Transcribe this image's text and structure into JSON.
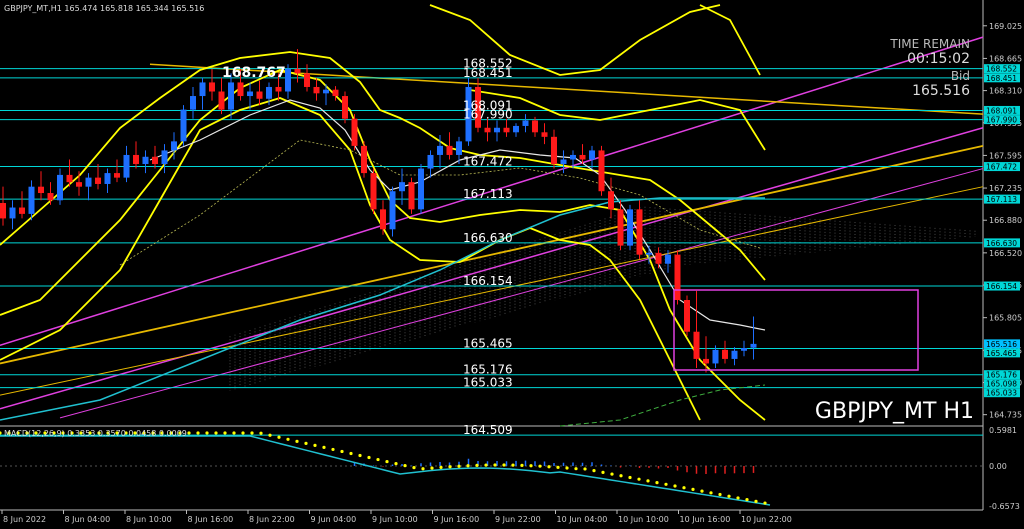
{
  "header": {
    "text": "GBPJPY_MT,H1  165.474 165.818 165.344 165.516"
  },
  "info_box": {
    "time_label": "TIME REMAIN",
    "time_value": "00:15:02",
    "bid_label": "Bid",
    "bid_value": "165.516"
  },
  "watermark": "GBPJPY_MT H1",
  "high_label": "168.767",
  "macd_header": "MACD(12,26,9) 0.3353 0.3570 0.0458 0.0009",
  "colors": {
    "bull": "#1e6fff",
    "bear": "#ff1a1a",
    "level": "#00d7d7",
    "yellow": "#ffff00",
    "magenta": "#e040e0",
    "orange": "#e6b800",
    "white_ma": "#e6e6e6",
    "cyan_ma": "#20c0d0"
  },
  "chart_data": {
    "type": "candlestick",
    "symbol": "GBPJPY_MT",
    "timeframe": "H1",
    "price_axis_ticks": [
      169.025,
      168.665,
      168.31,
      167.955,
      167.595,
      167.235,
      166.88,
      166.52,
      166.165,
      165.805,
      165.445,
      165.09,
      164.735
    ],
    "time_axis_ticks": [
      "8 Jun 2022",
      "8 Jun 04:00",
      "8 Jun 10:00",
      "8 Jun 16:00",
      "8 Jun 22:00",
      "9 Jun 04:00",
      "9 Jun 10:00",
      "9 Jun 16:00",
      "9 Jun 22:00",
      "10 Jun 04:00",
      "10 Jun 10:00",
      "10 Jun 16:00",
      "10 Jun 22:00"
    ],
    "horizontal_levels": [
      {
        "price": 168.552,
        "label": "168.552"
      },
      {
        "price": 168.451,
        "label": "168.451"
      },
      {
        "price": 168.091,
        "label": "168.091"
      },
      {
        "price": 167.99,
        "label": "167.990"
      },
      {
        "price": 167.472,
        "label": "167.472"
      },
      {
        "price": 167.113,
        "label": "167.113"
      },
      {
        "price": 166.63,
        "label": "166.630"
      },
      {
        "price": 166.154,
        "label": "166.154"
      },
      {
        "price": 165.465,
        "label": "165.465"
      },
      {
        "price": 165.176,
        "label": "165.176"
      },
      {
        "price": 165.033,
        "label": "165.033"
      },
      {
        "price": 164.509,
        "label": "164.509"
      }
    ],
    "right_axis_level_tags": [
      "168.552",
      "168.451",
      "168.091",
      "167.990",
      "167.472",
      "167.113",
      "166.630",
      "166.154",
      "165.516",
      "165.465",
      "165.176",
      "165.098",
      "165.033"
    ],
    "candles": [
      {
        "o": 167.07,
        "h": 167.25,
        "l": 166.82,
        "c": 166.9
      },
      {
        "o": 166.9,
        "h": 167.1,
        "l": 166.78,
        "c": 167.02
      },
      {
        "o": 167.02,
        "h": 167.2,
        "l": 166.9,
        "c": 166.95
      },
      {
        "o": 166.95,
        "h": 167.32,
        "l": 166.88,
        "c": 167.25
      },
      {
        "o": 167.25,
        "h": 167.42,
        "l": 167.1,
        "c": 167.18
      },
      {
        "o": 167.18,
        "h": 167.3,
        "l": 167.05,
        "c": 167.1
      },
      {
        "o": 167.1,
        "h": 167.45,
        "l": 167.05,
        "c": 167.38
      },
      {
        "o": 167.38,
        "h": 167.55,
        "l": 167.25,
        "c": 167.3
      },
      {
        "o": 167.3,
        "h": 167.42,
        "l": 167.15,
        "c": 167.25
      },
      {
        "o": 167.25,
        "h": 167.4,
        "l": 167.1,
        "c": 167.35
      },
      {
        "o": 167.35,
        "h": 167.5,
        "l": 167.22,
        "c": 167.28
      },
      {
        "o": 167.28,
        "h": 167.45,
        "l": 167.18,
        "c": 167.4
      },
      {
        "o": 167.4,
        "h": 167.55,
        "l": 167.3,
        "c": 167.35
      },
      {
        "o": 167.35,
        "h": 167.7,
        "l": 167.3,
        "c": 167.6
      },
      {
        "o": 167.6,
        "h": 167.75,
        "l": 167.45,
        "c": 167.5
      },
      {
        "o": 167.5,
        "h": 167.65,
        "l": 167.4,
        "c": 167.58
      },
      {
        "o": 167.58,
        "h": 167.7,
        "l": 167.45,
        "c": 167.5
      },
      {
        "o": 167.5,
        "h": 167.72,
        "l": 167.4,
        "c": 167.65
      },
      {
        "o": 167.65,
        "h": 167.85,
        "l": 167.55,
        "c": 167.75
      },
      {
        "o": 167.75,
        "h": 168.15,
        "l": 167.7,
        "c": 168.1
      },
      {
        "o": 168.1,
        "h": 168.35,
        "l": 168.0,
        "c": 168.25
      },
      {
        "o": 168.25,
        "h": 168.45,
        "l": 168.1,
        "c": 168.4
      },
      {
        "o": 168.4,
        "h": 168.55,
        "l": 168.2,
        "c": 168.3
      },
      {
        "o": 168.3,
        "h": 168.45,
        "l": 168.05,
        "c": 168.1
      },
      {
        "o": 168.1,
        "h": 168.5,
        "l": 168.0,
        "c": 168.4
      },
      {
        "o": 168.4,
        "h": 168.55,
        "l": 168.2,
        "c": 168.25
      },
      {
        "o": 168.25,
        "h": 168.4,
        "l": 168.1,
        "c": 168.3
      },
      {
        "o": 168.3,
        "h": 168.42,
        "l": 168.15,
        "c": 168.22
      },
      {
        "o": 168.22,
        "h": 168.4,
        "l": 168.15,
        "c": 168.35
      },
      {
        "o": 168.35,
        "h": 168.5,
        "l": 168.2,
        "c": 168.3
      },
      {
        "o": 168.3,
        "h": 168.6,
        "l": 168.22,
        "c": 168.55
      },
      {
        "o": 168.55,
        "h": 168.767,
        "l": 168.4,
        "c": 168.5
      },
      {
        "o": 168.5,
        "h": 168.6,
        "l": 168.3,
        "c": 168.35
      },
      {
        "o": 168.35,
        "h": 168.45,
        "l": 168.2,
        "c": 168.28
      },
      {
        "o": 168.28,
        "h": 168.38,
        "l": 168.15,
        "c": 168.32
      },
      {
        "o": 168.32,
        "h": 168.36,
        "l": 168.2,
        "c": 168.25
      },
      {
        "o": 168.25,
        "h": 168.3,
        "l": 167.95,
        "c": 168.0
      },
      {
        "o": 168.0,
        "h": 168.05,
        "l": 167.65,
        "c": 167.7
      },
      {
        "o": 167.7,
        "h": 167.75,
        "l": 167.35,
        "c": 167.4
      },
      {
        "o": 167.4,
        "h": 167.45,
        "l": 166.95,
        "c": 167.0
      },
      {
        "o": 167.0,
        "h": 167.1,
        "l": 166.72,
        "c": 166.78
      },
      {
        "o": 166.78,
        "h": 167.25,
        "l": 166.7,
        "c": 167.2
      },
      {
        "o": 167.2,
        "h": 167.45,
        "l": 167.05,
        "c": 167.3
      },
      {
        "o": 167.3,
        "h": 167.35,
        "l": 166.95,
        "c": 167.0
      },
      {
        "o": 167.0,
        "h": 167.5,
        "l": 166.95,
        "c": 167.45
      },
      {
        "o": 167.45,
        "h": 167.65,
        "l": 167.35,
        "c": 167.6
      },
      {
        "o": 167.6,
        "h": 167.82,
        "l": 167.45,
        "c": 167.7
      },
      {
        "o": 167.7,
        "h": 167.85,
        "l": 167.55,
        "c": 167.6
      },
      {
        "o": 167.6,
        "h": 167.8,
        "l": 167.5,
        "c": 167.75
      },
      {
        "o": 167.75,
        "h": 168.45,
        "l": 167.7,
        "c": 168.35
      },
      {
        "o": 168.35,
        "h": 168.45,
        "l": 167.85,
        "c": 167.9
      },
      {
        "o": 167.9,
        "h": 168.0,
        "l": 167.75,
        "c": 167.85
      },
      {
        "o": 167.85,
        "h": 167.98,
        "l": 167.75,
        "c": 167.9
      },
      {
        "o": 167.9,
        "h": 168.0,
        "l": 167.8,
        "c": 167.85
      },
      {
        "o": 167.85,
        "h": 167.95,
        "l": 167.8,
        "c": 167.92
      },
      {
        "o": 167.92,
        "h": 168.05,
        "l": 167.85,
        "c": 167.98
      },
      {
        "o": 167.98,
        "h": 168.02,
        "l": 167.8,
        "c": 167.85
      },
      {
        "o": 167.85,
        "h": 167.95,
        "l": 167.72,
        "c": 167.8
      },
      {
        "o": 167.8,
        "h": 167.88,
        "l": 167.45,
        "c": 167.5
      },
      {
        "o": 167.5,
        "h": 167.65,
        "l": 167.4,
        "c": 167.55
      },
      {
        "o": 167.55,
        "h": 167.65,
        "l": 167.45,
        "c": 167.6
      },
      {
        "o": 167.6,
        "h": 167.72,
        "l": 167.5,
        "c": 167.55
      },
      {
        "o": 167.55,
        "h": 167.7,
        "l": 167.45,
        "c": 167.65
      },
      {
        "o": 167.65,
        "h": 167.7,
        "l": 167.15,
        "c": 167.2
      },
      {
        "o": 167.2,
        "h": 167.35,
        "l": 166.9,
        "c": 167.0
      },
      {
        "o": 167.0,
        "h": 167.1,
        "l": 166.55,
        "c": 166.6
      },
      {
        "o": 166.6,
        "h": 167.05,
        "l": 166.55,
        "c": 167.0
      },
      {
        "o": 167.0,
        "h": 167.1,
        "l": 166.45,
        "c": 166.5
      },
      {
        "o": 166.5,
        "h": 166.6,
        "l": 166.4,
        "c": 166.52
      },
      {
        "o": 166.52,
        "h": 166.58,
        "l": 166.35,
        "c": 166.4
      },
      {
        "o": 166.4,
        "h": 166.55,
        "l": 166.3,
        "c": 166.5
      },
      {
        "o": 166.5,
        "h": 166.55,
        "l": 165.95,
        "c": 166.0
      },
      {
        "o": 166.0,
        "h": 166.05,
        "l": 165.6,
        "c": 165.65
      },
      {
        "o": 165.65,
        "h": 166.1,
        "l": 165.25,
        "c": 165.35
      },
      {
        "o": 165.35,
        "h": 165.6,
        "l": 165.2,
        "c": 165.3
      },
      {
        "o": 165.3,
        "h": 165.5,
        "l": 165.25,
        "c": 165.45
      },
      {
        "o": 165.45,
        "h": 165.55,
        "l": 165.3,
        "c": 165.35
      },
      {
        "o": 165.35,
        "h": 165.48,
        "l": 165.28,
        "c": 165.44
      },
      {
        "o": 165.44,
        "h": 165.55,
        "l": 165.38,
        "c": 165.47
      },
      {
        "o": 165.474,
        "h": 165.818,
        "l": 165.344,
        "c": 165.516
      }
    ],
    "macd_axis_ticks": [
      "0.5981",
      "0.00",
      "-0.6573"
    ]
  }
}
